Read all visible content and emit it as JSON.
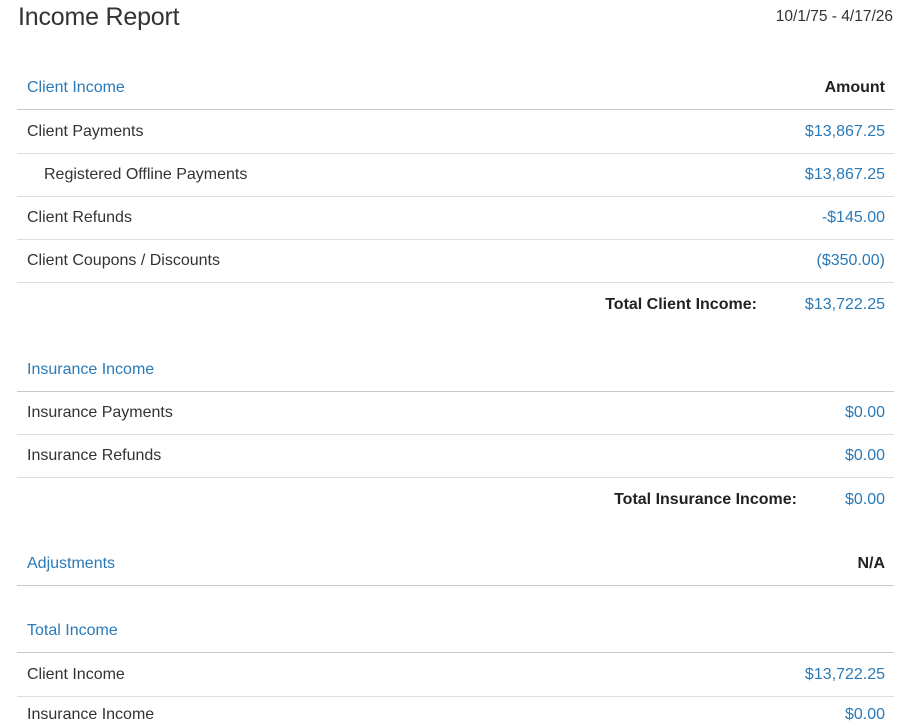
{
  "header": {
    "title": "Income Report",
    "date_range": "10/1/75 - 4/17/26"
  },
  "client_income": {
    "title": "Client Income",
    "amount_header": "Amount",
    "rows": [
      {
        "label": "Client Payments",
        "amount": "$13,867.25"
      },
      {
        "label": "Registered Offline Payments",
        "amount": "$13,867.25"
      },
      {
        "label": "Client Refunds",
        "amount": "-$145.00"
      },
      {
        "label": "Client Coupons / Discounts",
        "amount": "($350.00)"
      }
    ],
    "total_label": "Total Client Income:",
    "total_amount": "$13,722.25"
  },
  "insurance_income": {
    "title": "Insurance Income",
    "rows": [
      {
        "label": "Insurance Payments",
        "amount": "$0.00"
      },
      {
        "label": "Insurance Refunds",
        "amount": "$0.00"
      }
    ],
    "total_label": "Total Insurance Income:",
    "total_amount": "$0.00"
  },
  "adjustments": {
    "title": "Adjustments",
    "value": "N/A"
  },
  "total_income": {
    "title": "Total Income",
    "rows": [
      {
        "label": "Client Income",
        "amount": "$13,722.25"
      },
      {
        "label": "Insurance Income",
        "amount": "$0.00"
      }
    ]
  },
  "colors": {
    "accent_blue": "#2a7ab8",
    "text": "#333333",
    "divider": "#dddddd"
  }
}
